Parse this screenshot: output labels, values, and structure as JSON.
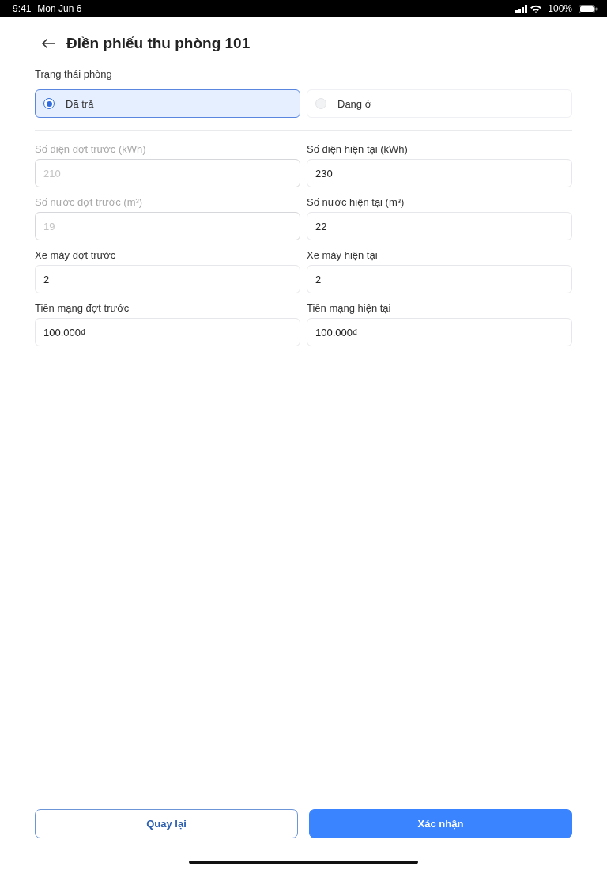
{
  "status_bar": {
    "time": "9:41",
    "date": "Mon Jun 6",
    "battery": "100%"
  },
  "header": {
    "title": "Điền phiếu thu phòng 101"
  },
  "room_status": {
    "label": "Trạng thái phòng",
    "options": [
      {
        "label": "Đã trả",
        "selected": true
      },
      {
        "label": "Đang ở",
        "selected": false
      }
    ]
  },
  "fields": [
    {
      "label": "Số điện đợt trước (kWh)",
      "value": "210",
      "disabled": true
    },
    {
      "label": "Số điện hiện tại (kWh)",
      "value": "230",
      "disabled": false
    },
    {
      "label": "Số nước đợt trước (m³)",
      "value": "19",
      "disabled": true
    },
    {
      "label": "Số nước hiện tại (m³)",
      "value": "22",
      "disabled": false
    },
    {
      "label": "Xe máy đợt trước",
      "value": "2",
      "disabled": false
    },
    {
      "label": "Xe máy hiện tại",
      "value": "2",
      "disabled": false
    },
    {
      "label": "Tiền mạng đợt trước",
      "value": "100.000₫",
      "disabled": false
    },
    {
      "label": "Tiền mạng hiện tại",
      "value": "100.000₫",
      "disabled": false
    }
  ],
  "buttons": [
    {
      "label": "Quay lại",
      "kind": "secondary"
    },
    {
      "label": "Xác nhận",
      "kind": "primary"
    }
  ]
}
